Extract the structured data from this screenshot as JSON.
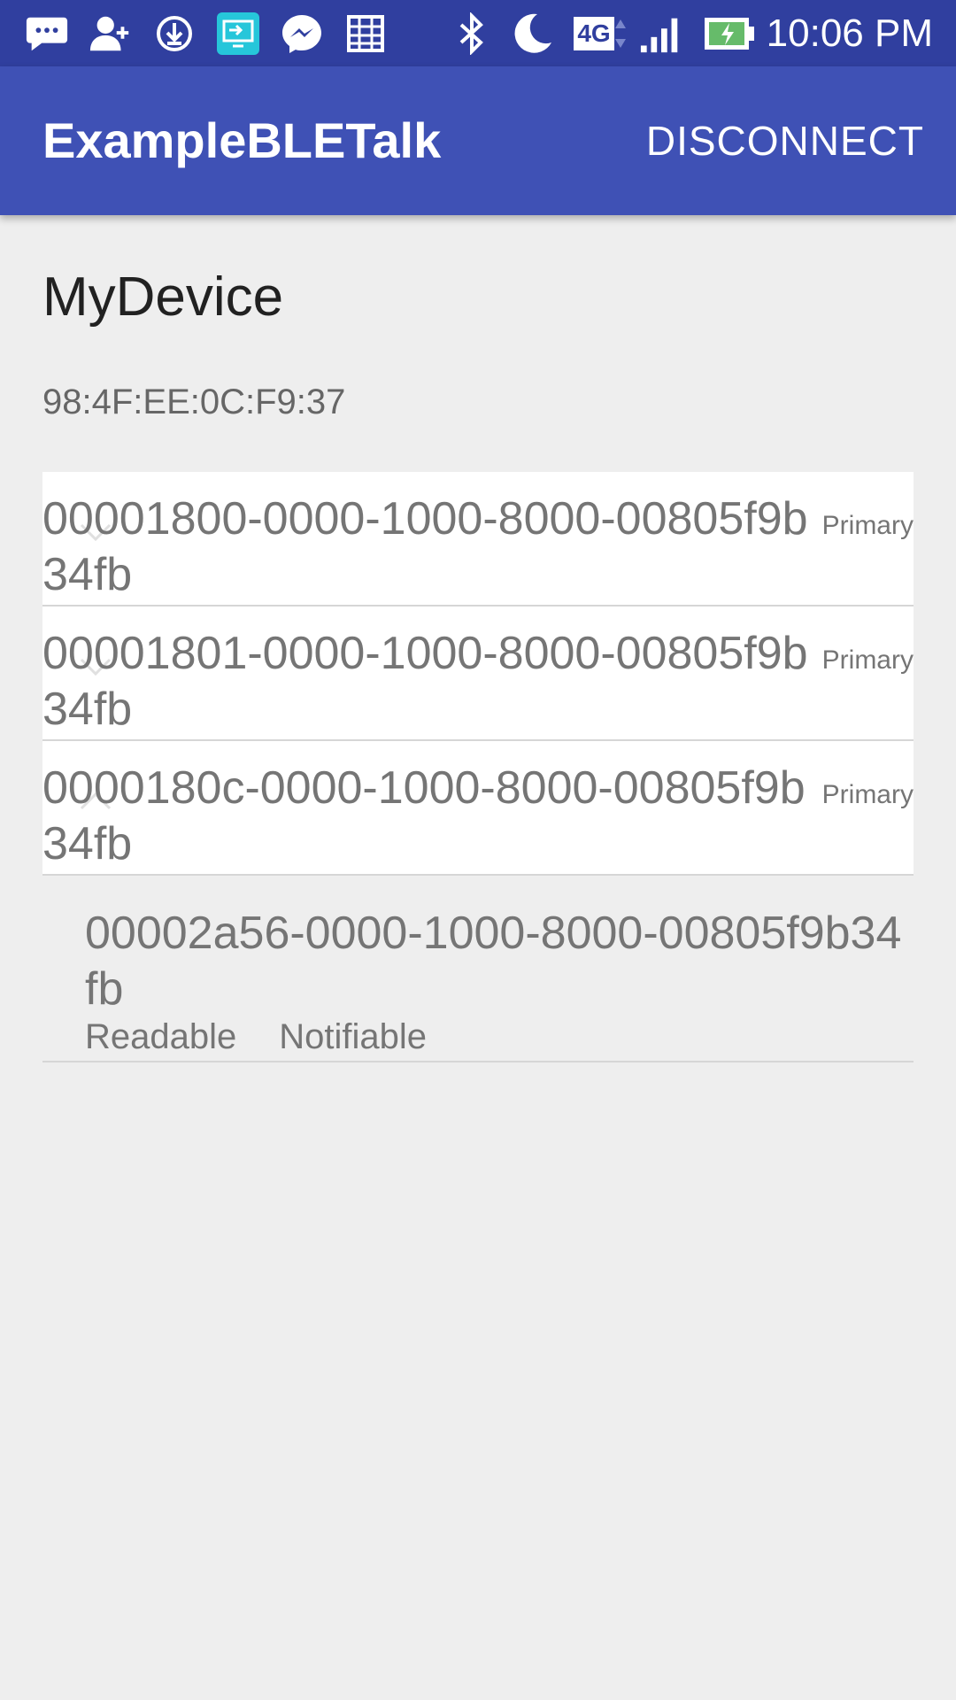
{
  "status_bar": {
    "time": "10:06 PM",
    "network": "4G",
    "icons": [
      "messaging-icon",
      "add-contact-icon",
      "download-icon",
      "screen-cast-icon",
      "messenger-icon",
      "calendar-icon",
      "bluetooth-icon",
      "moon-icon",
      "network-4g-icon",
      "signal-icon",
      "battery-charging-icon"
    ]
  },
  "app_bar": {
    "title": "ExampleBLETalk",
    "action": "DISCONNECT",
    "color": "#3f51b5",
    "status_color": "#303f9f"
  },
  "device": {
    "name": "MyDevice",
    "address": "98:4F:EE:0C:F9:37"
  },
  "services": [
    {
      "uuid": "00001800-0000-1000-8000-00805f9b34fb",
      "type": "Primary"
    },
    {
      "uuid": "00001801-0000-1000-8000-00805f9b34fb",
      "type": "Primary"
    },
    {
      "uuid": "0000180c-0000-1000-8000-00805f9b34fb",
      "type": "Primary"
    }
  ],
  "characteristics": [
    {
      "uuid": "00002a56-0000-1000-8000-00805f9b34fb",
      "properties": [
        "Readable",
        "Notifiable"
      ]
    }
  ]
}
